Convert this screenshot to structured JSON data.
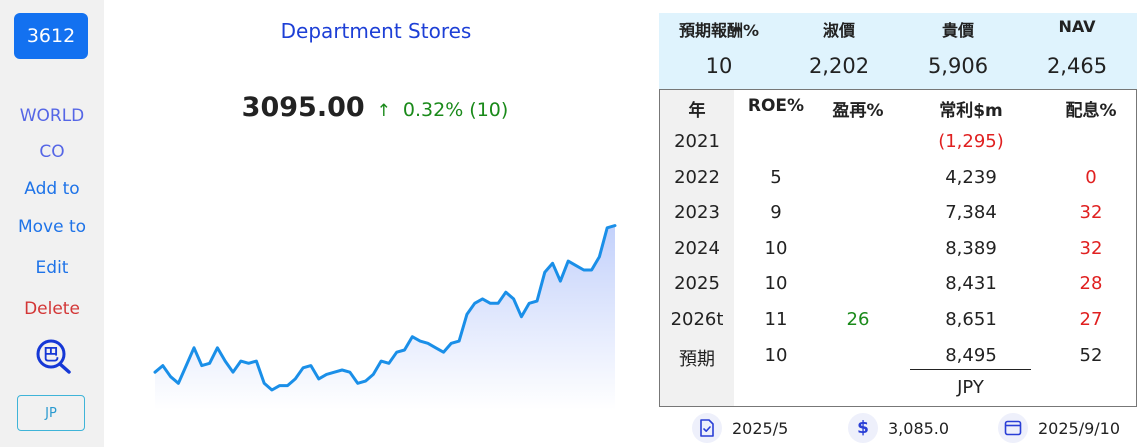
{
  "sidebar": {
    "ticker": "3612",
    "company_line1": "WORLD",
    "company_line2": "CO",
    "add_to": "Add to",
    "move_to": "Move to",
    "edit": "Edit",
    "delete": "Delete",
    "magnifier_icon": "magnifier-ba-icon",
    "magnifier_char": "巴",
    "market_button": "JP"
  },
  "quote": {
    "industry": "Department Stores",
    "price": "3095.00",
    "arrow": "↑",
    "change": "0.32% (10)"
  },
  "chart_data": {
    "type": "area",
    "title": "",
    "xlabel": "",
    "ylabel": "",
    "color": "#1a8fe8",
    "fill_color": "#c9d6fb",
    "values": [
      2670,
      2700,
      2650,
      2620,
      2700,
      2780,
      2700,
      2710,
      2780,
      2720,
      2670,
      2720,
      2710,
      2720,
      2620,
      2590,
      2610,
      2610,
      2640,
      2690,
      2700,
      2640,
      2660,
      2670,
      2680,
      2670,
      2620,
      2630,
      2660,
      2720,
      2710,
      2760,
      2770,
      2830,
      2810,
      2800,
      2780,
      2760,
      2800,
      2810,
      2930,
      2980,
      3000,
      2980,
      2980,
      3030,
      3000,
      2920,
      2980,
      2990,
      3120,
      3160,
      3080,
      3170,
      3150,
      3130,
      3130,
      3190,
      3320,
      3330
    ]
  },
  "summary": {
    "headers": [
      "預期報酬%",
      "淑價",
      "貴價",
      "NAV"
    ],
    "values": [
      "10",
      "2,202",
      "5,906",
      "2,465"
    ]
  },
  "table": {
    "headers": [
      "年",
      "ROE%",
      "盈再%",
      "常利$m",
      "配息%"
    ],
    "rows": [
      {
        "year": "2021",
        "roe": "",
        "reinvest": "",
        "profit": "(1,295)",
        "dividend": ""
      },
      {
        "year": "2022",
        "roe": "5",
        "reinvest": "",
        "profit": "4,239",
        "dividend": "0"
      },
      {
        "year": "2023",
        "roe": "9",
        "reinvest": "",
        "profit": "7,384",
        "dividend": "32"
      },
      {
        "year": "2024",
        "roe": "10",
        "reinvest": "",
        "profit": "8,389",
        "dividend": "32"
      },
      {
        "year": "2025",
        "roe": "10",
        "reinvest": "",
        "profit": "8,431",
        "dividend": "28"
      },
      {
        "year": "2026t",
        "roe": "11",
        "reinvest": "26",
        "profit": "8,651",
        "dividend": "27"
      },
      {
        "year": "預期",
        "roe": "10",
        "reinvest": "",
        "profit": "8,495",
        "dividend": "52"
      }
    ],
    "currency": "JPY"
  },
  "colors": {
    "negative": "#e02020",
    "positive": "#1a8a1a",
    "accent": "#1371f0"
  },
  "footer": {
    "report_icon": "document-check-icon",
    "report_date": "2025/5",
    "price_icon": "dollar-icon",
    "price_symbol": "$",
    "price": "3,085.0",
    "calendar_icon": "calendar-icon",
    "date": "2025/9/10"
  }
}
